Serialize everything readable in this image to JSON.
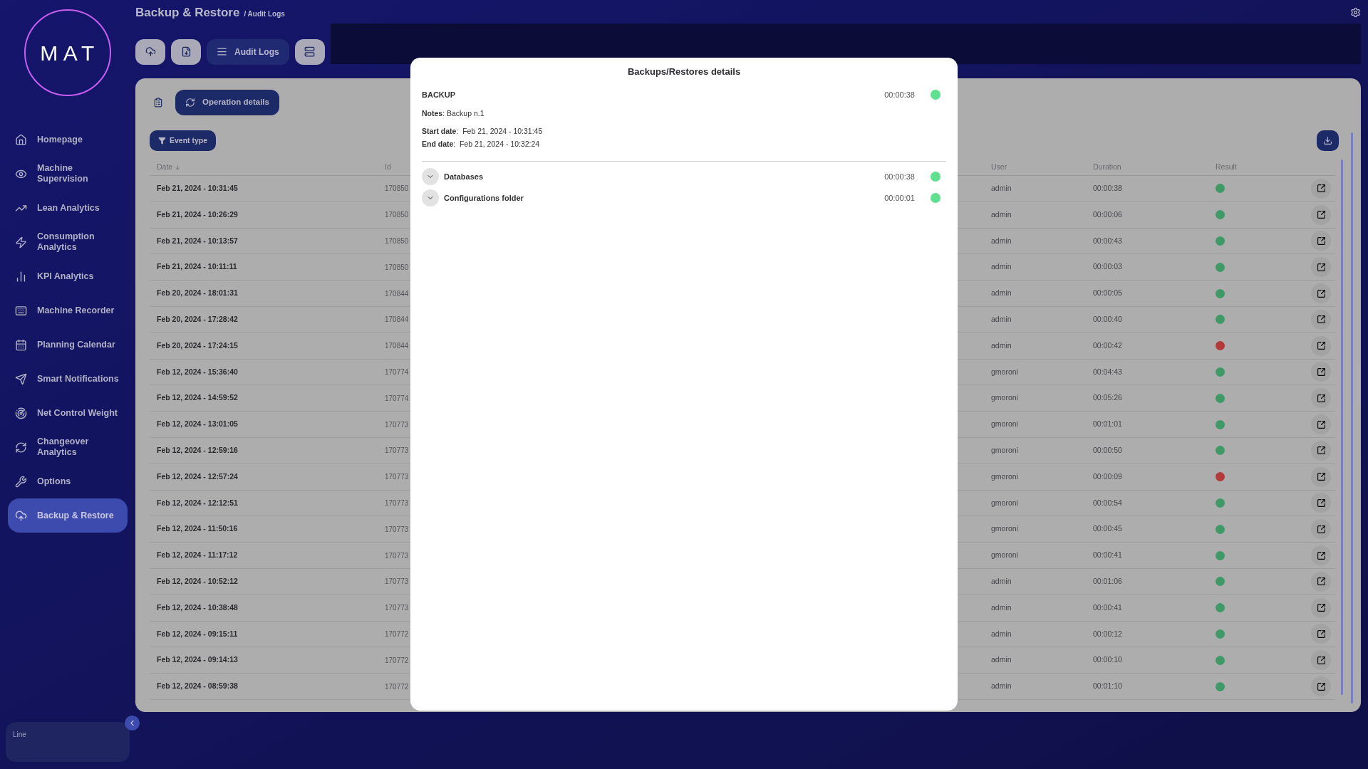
{
  "header": {
    "title": "Backup & Restore",
    "breadcrumb": "/ Audit Logs"
  },
  "sidebar": {
    "logo": "MAT",
    "items": [
      {
        "label": "Homepage",
        "kind": "home",
        "selected": false
      },
      {
        "label": "Machine Supervision",
        "kind": "eye",
        "selected": false
      },
      {
        "label": "Lean Analytics",
        "kind": "trend",
        "selected": false
      },
      {
        "label": "Consumption Analytics",
        "kind": "bolt",
        "selected": false
      },
      {
        "label": "KPI Analytics",
        "kind": "bars",
        "selected": false
      },
      {
        "label": "Machine Recorder",
        "kind": "recorder",
        "selected": false
      },
      {
        "label": "Planning Calendar",
        "kind": "calendar",
        "selected": false
      },
      {
        "label": "Smart Notifications",
        "kind": "send",
        "selected": false
      },
      {
        "label": "Net Control Weight",
        "kind": "radar",
        "selected": false
      },
      {
        "label": "Changeover Analytics",
        "kind": "refresh",
        "selected": false
      },
      {
        "label": "Options",
        "kind": "wrench",
        "selected": false
      },
      {
        "label": "Backup & Restore",
        "kind": "cloud",
        "selected": true
      }
    ],
    "line_card": {
      "label": "Line"
    }
  },
  "toolbar": [
    {
      "kind": "cloud",
      "selected": false
    },
    {
      "kind": "file",
      "selected": false
    },
    {
      "kind": "list",
      "label": "Audit Logs",
      "selected": true
    },
    {
      "kind": "server",
      "selected": false
    }
  ],
  "tabs": [
    {
      "kind": "clipboard",
      "selected": false
    },
    {
      "kind": "refresh",
      "label": "Operation details",
      "selected": true
    }
  ],
  "filter": {
    "label": "Event type"
  },
  "table": {
    "columns": [
      "Date",
      "Id",
      "User",
      "Duration",
      "Result"
    ],
    "rows": [
      {
        "date": "Feb 21, 2024 - 10:31:45",
        "id": "170850",
        "user": "admin",
        "duration": "00:00:38",
        "color": "#3f9a67"
      },
      {
        "date": "Feb 21, 2024 - 10:26:29",
        "id": "170850",
        "user": "admin",
        "duration": "00:00:06",
        "color": "#3f9a67"
      },
      {
        "date": "Feb 21, 2024 - 10:13:57",
        "id": "170850",
        "user": "admin",
        "duration": "00:00:43",
        "color": "#3f9a67"
      },
      {
        "date": "Feb 21, 2024 - 10:11:11",
        "id": "170850",
        "user": "admin",
        "duration": "00:00:03",
        "color": "#3f9a67"
      },
      {
        "date": "Feb 20, 2024 - 18:01:31",
        "id": "170844",
        "user": "admin",
        "duration": "00:00:05",
        "color": "#3f9a67"
      },
      {
        "date": "Feb 20, 2024 - 17:28:42",
        "id": "170844",
        "user": "admin",
        "duration": "00:00:40",
        "color": "#3f9a67"
      },
      {
        "date": "Feb 20, 2024 - 17:24:15",
        "id": "170844",
        "user": "admin",
        "duration": "00:00:42",
        "color": "#b33a3a"
      },
      {
        "date": "Feb 12, 2024 - 15:36:40",
        "id": "170774",
        "user": "gmoroni",
        "duration": "00:04:43",
        "color": "#3f9a67"
      },
      {
        "date": "Feb 12, 2024 - 14:59:52",
        "id": "170774",
        "user": "gmoroni",
        "duration": "00:05:26",
        "color": "#3f9a67"
      },
      {
        "date": "Feb 12, 2024 - 13:01:05",
        "id": "170773",
        "user": "gmoroni",
        "duration": "00:01:01",
        "color": "#3f9a67"
      },
      {
        "date": "Feb 12, 2024 - 12:59:16",
        "id": "170773",
        "user": "gmoroni",
        "duration": "00:00:50",
        "color": "#3f9a67"
      },
      {
        "date": "Feb 12, 2024 - 12:57:24",
        "id": "170773",
        "user": "gmoroni",
        "duration": "00:00:09",
        "color": "#b33a3a"
      },
      {
        "date": "Feb 12, 2024 - 12:12:51",
        "id": "170773",
        "user": "gmoroni",
        "duration": "00:00:54",
        "color": "#3f9a67"
      },
      {
        "date": "Feb 12, 2024 - 11:50:16",
        "id": "170773",
        "user": "gmoroni",
        "duration": "00:00:45",
        "color": "#3f9a67"
      },
      {
        "date": "Feb 12, 2024 - 11:17:12",
        "id": "170773",
        "user": "gmoroni",
        "duration": "00:00:41",
        "color": "#3f9a67"
      },
      {
        "date": "Feb 12, 2024 - 10:52:12",
        "id": "170773",
        "user": "admin",
        "duration": "00:01:06",
        "color": "#3f9a67"
      },
      {
        "date": "Feb 12, 2024 - 10:38:48",
        "id": "170773",
        "user": "admin",
        "duration": "00:00:41",
        "color": "#3f9a67"
      },
      {
        "date": "Feb 12, 2024 - 09:15:11",
        "id": "170772",
        "user": "admin",
        "duration": "00:00:12",
        "color": "#3f9a67"
      },
      {
        "date": "Feb 12, 2024 - 09:14:13",
        "id": "170772",
        "user": "admin",
        "duration": "00:00:10",
        "color": "#3f9a67"
      },
      {
        "date": "Feb 12, 2024 - 08:59:38",
        "id": "170772",
        "user": "admin",
        "duration": "00:01:10",
        "color": "#3f9a67"
      }
    ]
  },
  "modal": {
    "title": "Backups/Restores details",
    "type": "BACKUP",
    "duration": "00:00:38",
    "color": "#5ee08f",
    "notes_label": "Notes",
    "notes": ": Backup n.1",
    "start_label": "Start date",
    "start": ":  Feb 21, 2024 - 10:31:45",
    "end_label": "End date",
    "end": ":  Feb 21, 2024 - 10:32:24",
    "sections": [
      {
        "label": "Databases",
        "duration": "00:00:38",
        "color": "#5ee08f",
        "expanded": false
      },
      {
        "label": "Configurations folder",
        "duration": "00:00:01",
        "color": "#5ee08f",
        "expanded": false
      }
    ]
  }
}
